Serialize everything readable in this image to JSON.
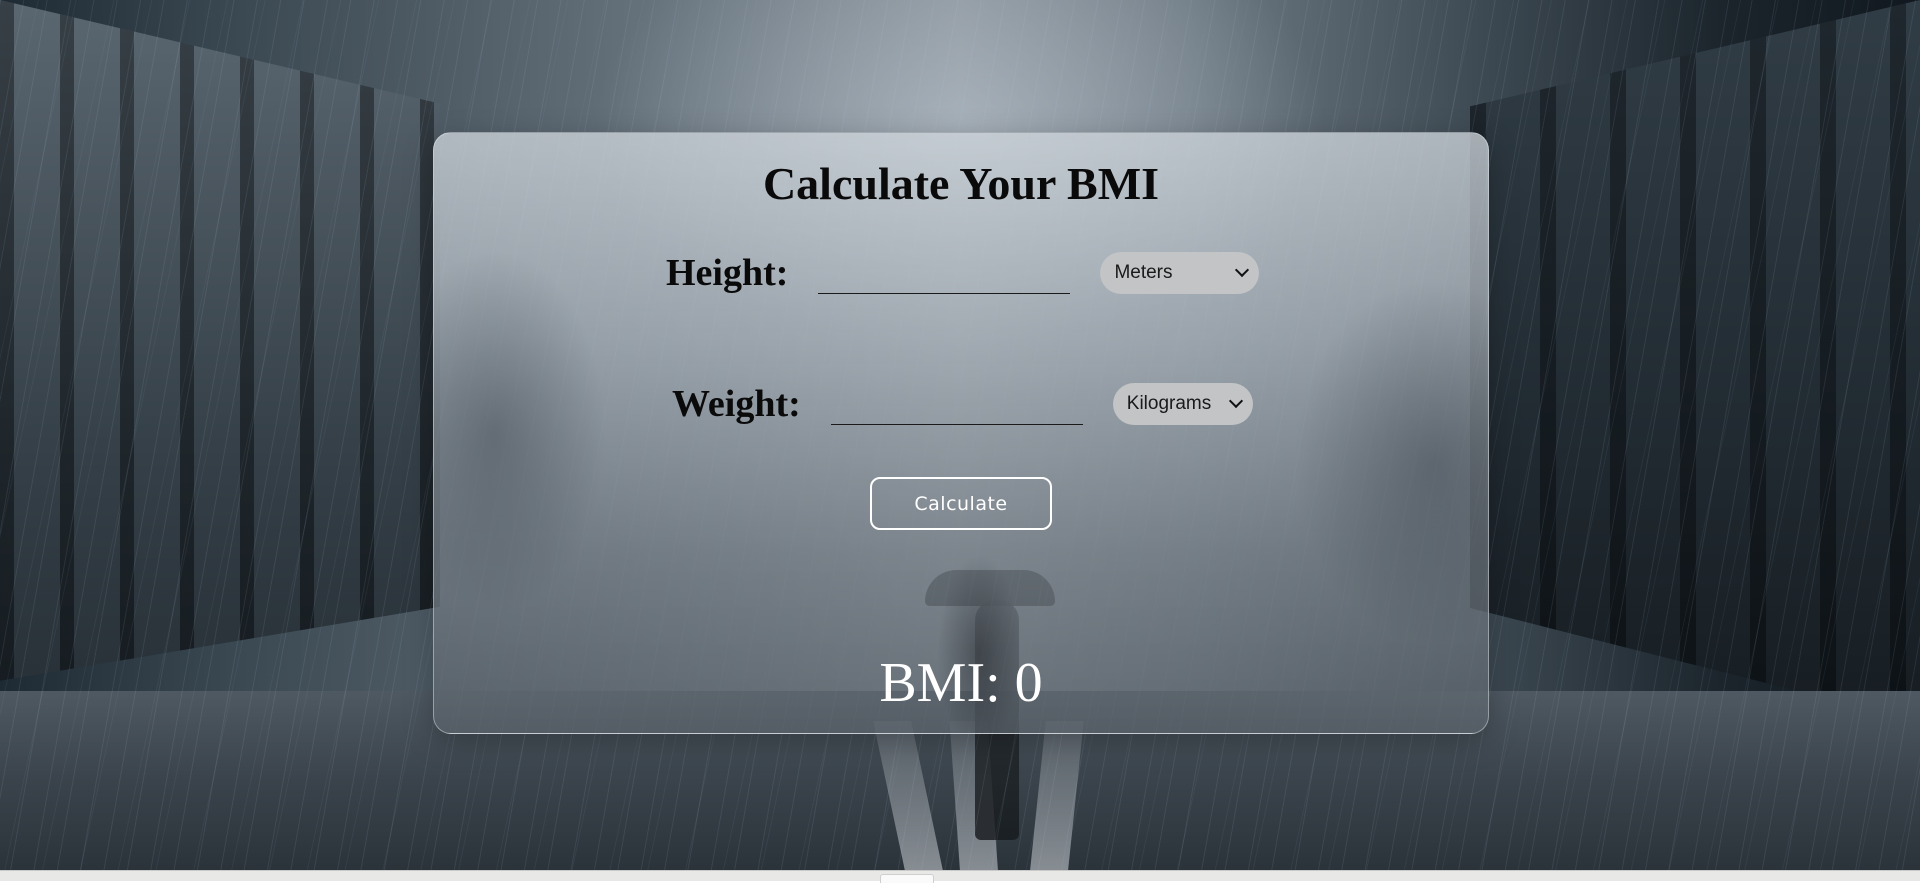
{
  "page": {
    "title": "Calculate Your BMI"
  },
  "form": {
    "height": {
      "label": "Height:",
      "value": "",
      "unit_selected": "Meters"
    },
    "weight": {
      "label": "Weight:",
      "value": "",
      "unit_selected": "Kilograms"
    },
    "calculate_label": "Calculate"
  },
  "result": {
    "text": "BMI: 0"
  },
  "icons": {
    "select_chevron": "chevron-down-icon"
  },
  "colors": {
    "title_text": "#0a0a0a",
    "result_text": "#ffffff",
    "button_border": "#ffffff",
    "select_bg": "#c2c4c6"
  }
}
